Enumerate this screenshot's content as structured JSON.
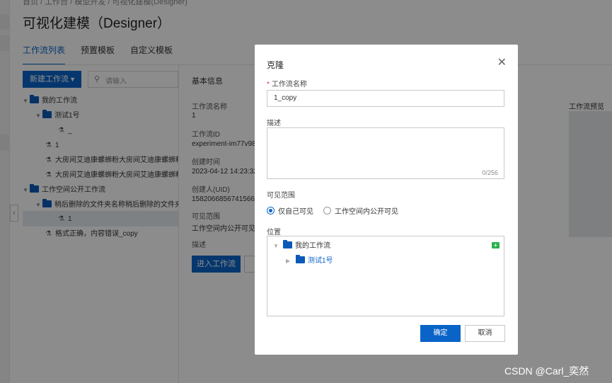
{
  "breadcrumb": "首页 / 工作台 / 模型开发 / 可视化建模(Designer)",
  "page_title": "可视化建模（Designer）",
  "tabs": [
    {
      "label": "工作流列表"
    },
    {
      "label": "预置模板"
    },
    {
      "label": "自定义模板"
    }
  ],
  "sidebar": {
    "new_button": "新建工作流",
    "search_placeholder": "请输入",
    "tree": [
      {
        "label": "我的工作流"
      },
      {
        "label": "测试1号"
      },
      {
        "label": "_"
      },
      {
        "label": "1"
      },
      {
        "label": "大房间艾迪康螺蛳粉大房间艾迪康螺蛳粉大房"
      },
      {
        "label": "大房间艾迪康螺蛳粉大房间艾迪康螺蛳粉大房"
      },
      {
        "label": "工作空间公开工作流"
      },
      {
        "label": "稍后删除的文件夹名称稍后删除的文件夹名称"
      },
      {
        "label": "1"
      },
      {
        "label": "格式正确，内容错误_copy"
      }
    ]
  },
  "details": {
    "section_title": "基本信息",
    "fields": [
      {
        "label": "工作流名称",
        "value": "1"
      },
      {
        "label": "工作流ID",
        "value": "experiment-im77v98"
      },
      {
        "label": "创建时间",
        "value": "2023-04-12 14:23:32"
      },
      {
        "label": "创建人(UID)",
        "value": "1582066856741566"
      },
      {
        "label": "可见范围",
        "value": "工作空间内公开可见"
      },
      {
        "label": "描述",
        "value": ""
      }
    ],
    "enter_button": "进入工作流",
    "preview_label": "工作流预览"
  },
  "modal": {
    "title": "克隆",
    "name_label": "工作流名称",
    "name_value": "1_copy",
    "desc_label": "描述",
    "desc_count": "0/256",
    "visibility_label": "可见范围",
    "visibility_options": [
      {
        "label": "仅自己可见",
        "checked": true
      },
      {
        "label": "工作空间内公开可见",
        "checked": false
      }
    ],
    "location_label": "位置",
    "location_tree": [
      {
        "label": "我的工作流"
      },
      {
        "label": "测试1号"
      }
    ],
    "ok_button": "确定",
    "cancel_button": "取消"
  },
  "watermark": "CSDN @Carl_奕然",
  "colors": {
    "primary": "#0a64c8",
    "folder": "#0a5ab8",
    "add_folder": "#2bb24c",
    "required": "#d9363e"
  }
}
